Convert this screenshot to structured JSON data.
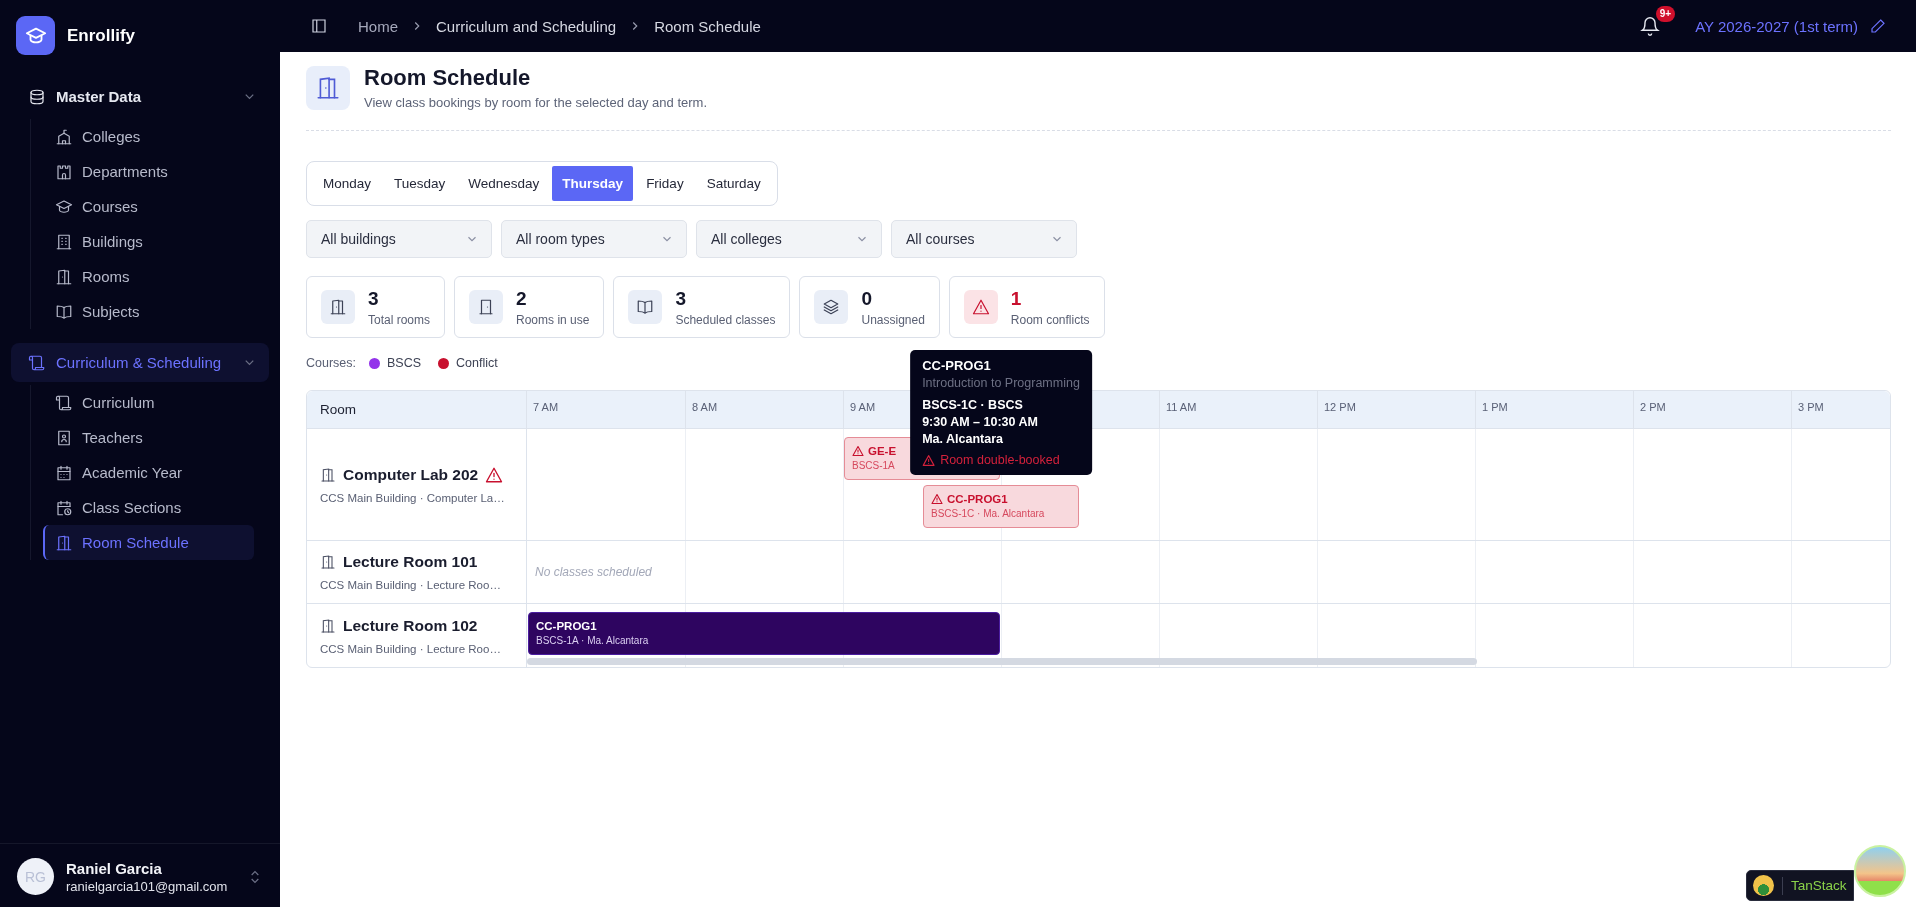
{
  "sidebar": {
    "brand": "Enrollify",
    "groups": [
      {
        "label": "Master Data",
        "kind": "database",
        "expanded": true,
        "selected": false,
        "items": [
          {
            "label": "Colleges",
            "kind": "college",
            "selected": false
          },
          {
            "label": "Departments",
            "kind": "castle",
            "selected": false
          },
          {
            "label": "Courses",
            "kind": "cap",
            "selected": false
          },
          {
            "label": "Buildings",
            "kind": "building",
            "selected": false
          },
          {
            "label": "Rooms",
            "kind": "door",
            "selected": false
          },
          {
            "label": "Subjects",
            "kind": "book",
            "selected": false
          }
        ]
      },
      {
        "label": "Curriculum & Scheduling",
        "kind": "scroll",
        "expanded": true,
        "selected": true,
        "items": [
          {
            "label": "Curriculum",
            "kind": "scroll",
            "selected": false
          },
          {
            "label": "Teachers",
            "kind": "contact",
            "selected": false
          },
          {
            "label": "Academic Year",
            "kind": "calendar",
            "selected": false
          },
          {
            "label": "Class Sections",
            "kind": "calendar-clock",
            "selected": false
          },
          {
            "label": "Room Schedule",
            "kind": "door",
            "selected": true
          }
        ]
      }
    ],
    "user": {
      "initials": "RG",
      "name": "Raniel Garcia",
      "email": "ranielgarcia101@gmail.com"
    }
  },
  "header": {
    "breadcrumb": [
      "Home",
      "Curriculum and Scheduling",
      "Room Schedule"
    ],
    "notification_badge": "9+",
    "term": "AY 2026-2027 (1st term)"
  },
  "page": {
    "title": "Room Schedule",
    "subtitle": "View class bookings by room for the selected day and term."
  },
  "days": [
    {
      "label": "Monday",
      "selected": false
    },
    {
      "label": "Tuesday",
      "selected": false
    },
    {
      "label": "Wednesday",
      "selected": false
    },
    {
      "label": "Thursday",
      "selected": true
    },
    {
      "label": "Friday",
      "selected": false
    },
    {
      "label": "Saturday",
      "selected": false
    }
  ],
  "filters": [
    "All buildings",
    "All room types",
    "All colleges",
    "All courses"
  ],
  "stats": [
    {
      "kind": "rooms",
      "value": "3",
      "label": "Total rooms"
    },
    {
      "kind": "in-use",
      "value": "2",
      "label": "Rooms in use"
    },
    {
      "kind": "classes",
      "value": "3",
      "label": "Scheduled classes"
    },
    {
      "kind": "unassigned",
      "value": "0",
      "label": "Unassigned"
    },
    {
      "kind": "conflicts",
      "value": "1",
      "label": "Room conflicts"
    }
  ],
  "legend": {
    "label": "Courses:",
    "items": [
      {
        "label": "BSCS",
        "color": "#9333ea"
      },
      {
        "label": "Conflict",
        "color": "#c8102e"
      }
    ]
  },
  "schedule": {
    "room_header": "Room",
    "hours": [
      "7 AM",
      "8 AM",
      "9 AM",
      "11 AM",
      "12 PM",
      "1 PM",
      "2 PM",
      "3 PM"
    ],
    "rooms": [
      {
        "name": "Computer Lab 202",
        "subtitle": "CCS Main Building · Computer La…",
        "conflict": true,
        "events": [
          {
            "code": "GE-E",
            "detail": "BSCS-1A",
            "conflict": true
          },
          {
            "code": "CC-PROG1",
            "detail": "BSCS-1C · Ma. Alcantara",
            "conflict": true,
            "tooltip": {
              "code": "CC-PROG1",
              "title": "Introduction to Programming",
              "lines": [
                "BSCS-1C · BSCS",
                "9:30 AM – 10:30 AM",
                "Ma. Alcantara"
              ],
              "warning": "Room double-booked"
            }
          }
        ]
      },
      {
        "name": "Lecture Room 101",
        "subtitle": "CCS Main Building · Lecture Roo…",
        "conflict": false,
        "empty_text": "No classes scheduled"
      },
      {
        "name": "Lecture Room 102",
        "subtitle": "CCS Main Building · Lecture Roo…",
        "conflict": false,
        "events": [
          {
            "code": "CC-PROG1",
            "detail": "BSCS-1A · Ma. Alcantara",
            "conflict": false
          }
        ]
      }
    ]
  },
  "devtools": {
    "label": "TanStack"
  }
}
